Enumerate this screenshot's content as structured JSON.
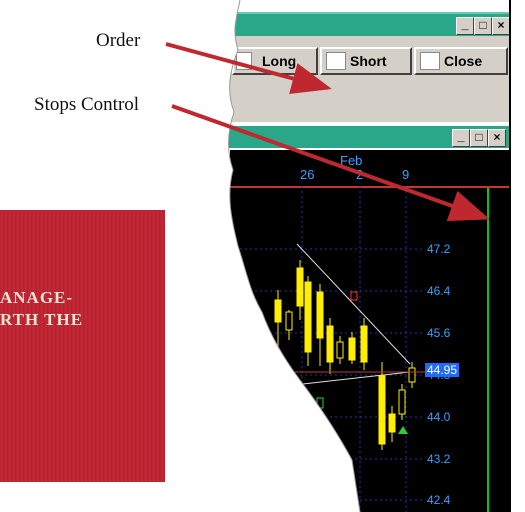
{
  "banner": {
    "line1": "ANAGE-",
    "line2": "RTH THE"
  },
  "callouts": {
    "order": "Order",
    "stops": "Stops Control"
  },
  "window1": {
    "btn_min": "_",
    "btn_max": "□",
    "btn_close": "×"
  },
  "toolbar": {
    "long": "Long",
    "short": "Short",
    "close": "Close"
  },
  "window2": {
    "btn_min": "_",
    "btn_max": "□",
    "btn_close": "×"
  },
  "chart_axis": {
    "month": "Feb",
    "days": [
      "26",
      "2",
      "9"
    ],
    "prices": [
      "47.2",
      "46.4",
      "45.6",
      "44.8",
      "44.0",
      "43.2",
      "42.4"
    ],
    "current_price": "44.95"
  },
  "colors": {
    "titlebar": "#2aa789",
    "chart_bg": "#000000",
    "banner": "#c0282f",
    "arrow": "#c0282f"
  }
}
